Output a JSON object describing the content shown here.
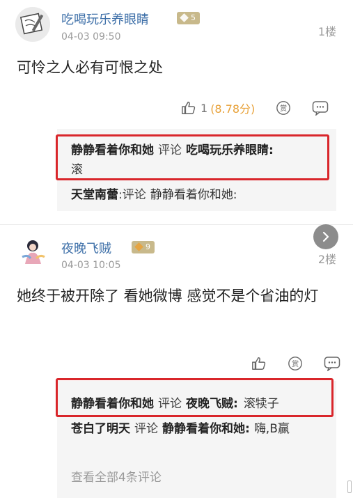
{
  "posts": [
    {
      "username": "吃喝玩乐养眼睛",
      "level": "5",
      "time": "04-03 09:50",
      "floor": "1楼",
      "content": "可怜之人必有可恨之处",
      "likes": "1",
      "score": "(8.78分)",
      "replies": [
        {
          "from": "静静看着你和她",
          "verb": "评论",
          "to": "吃喝玩乐养眼睛:",
          "text": "滚"
        },
        {
          "from": "天堂南蕾",
          "verb": ":评论",
          "to": "静静看着你和她:",
          "text": ""
        }
      ]
    },
    {
      "username": "夜晚飞贼",
      "level": "9",
      "time": "04-03 10:05",
      "floor": "2楼",
      "content": "她终于被开除了 看她微博 感觉不是个省油的灯",
      "replies": [
        {
          "from": "静静看着你和她",
          "verb": "评论",
          "to": "夜晚飞贼:",
          "text": "滚犊子"
        },
        {
          "from": "苍白了明天",
          "verb": "评论",
          "to": "静静看着你和她:",
          "text": "嗨,B赢"
        }
      ],
      "more_comments": "查看全部4条评论"
    }
  ],
  "colors": {
    "username": "#3d6fa8",
    "score": "#e8a23a",
    "highlight": "#d9262b",
    "level_badge": "#c8b98b"
  },
  "icons": [
    "like-icon",
    "reward-icon",
    "comment-icon",
    "chevron-right-icon"
  ]
}
